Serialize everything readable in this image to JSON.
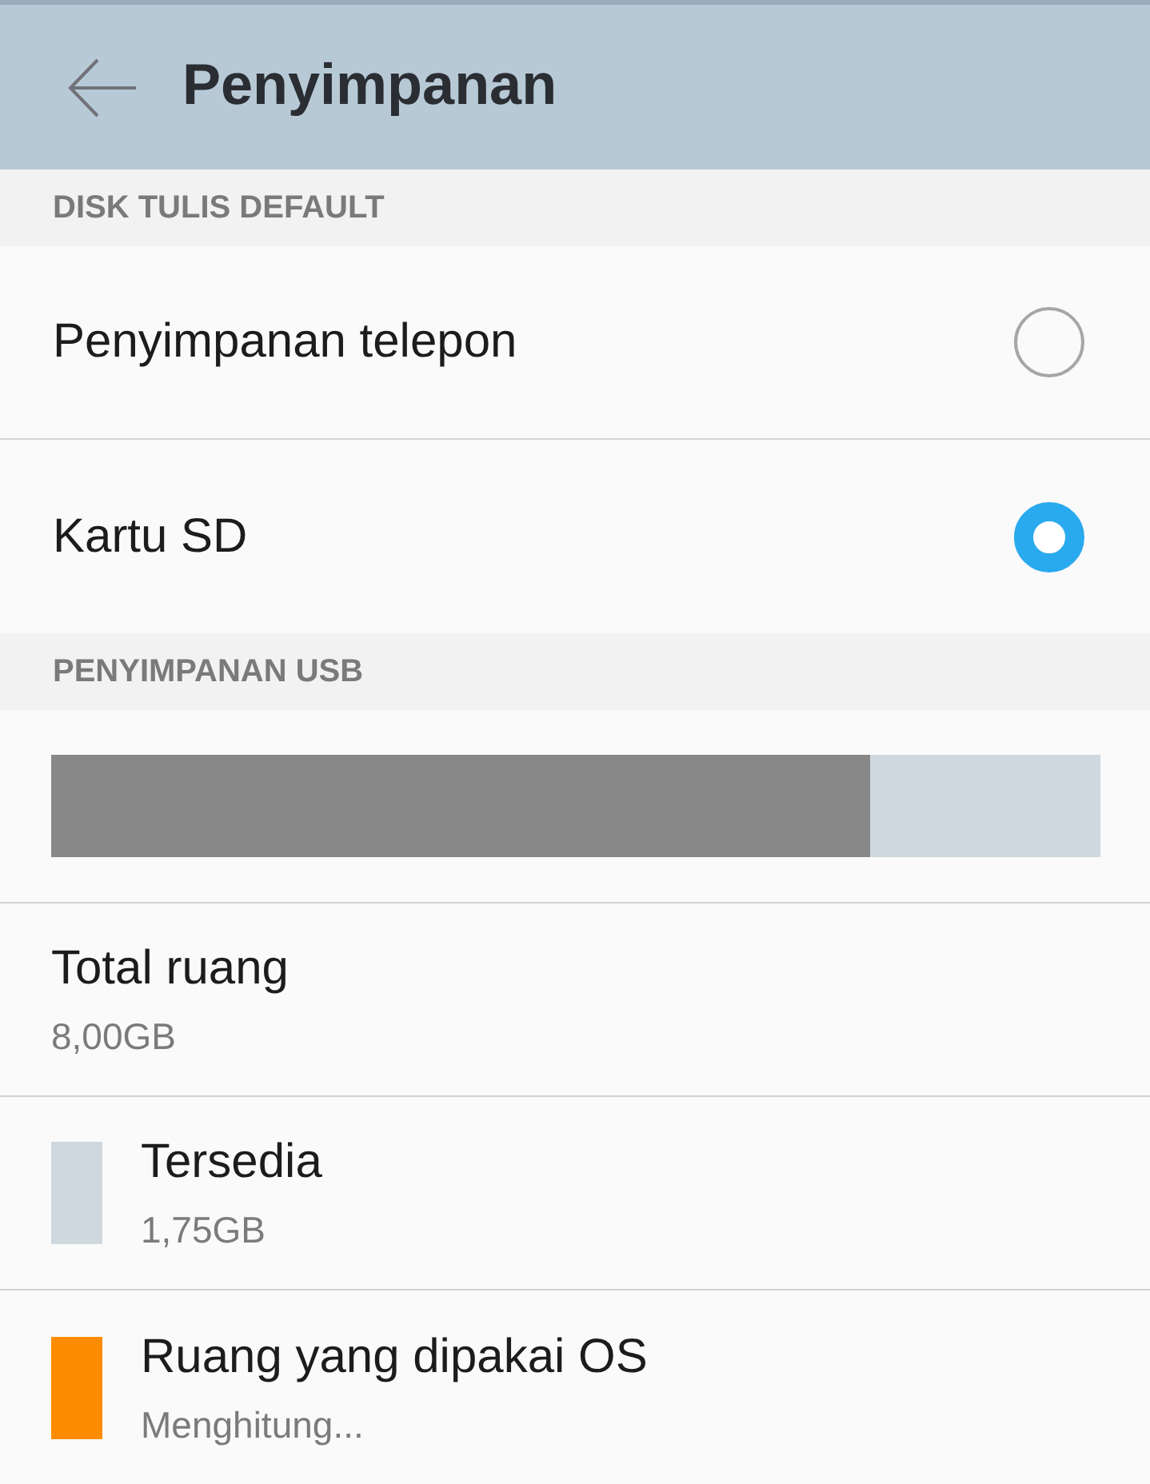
{
  "header": {
    "title": "Penyimpanan"
  },
  "default_disk": {
    "heading": "DISK TULIS DEFAULT",
    "options": [
      {
        "label": "Penyimpanan telepon",
        "selected": false
      },
      {
        "label": "Kartu SD",
        "selected": true
      }
    ]
  },
  "usb_storage": {
    "heading": "PENYIMPANAN USB",
    "usage_bar": {
      "level": 0.78
    },
    "rows": [
      {
        "kind": "total",
        "title": "Total ruang",
        "value": "8,00GB"
      },
      {
        "kind": "legend",
        "title": "Tersedia",
        "value": "1,75GB",
        "color": "#cfd8de"
      },
      {
        "kind": "legend",
        "title": "Ruang yang dipakai OS",
        "value": "Menghitung...",
        "color": "#ff8c00"
      }
    ]
  }
}
